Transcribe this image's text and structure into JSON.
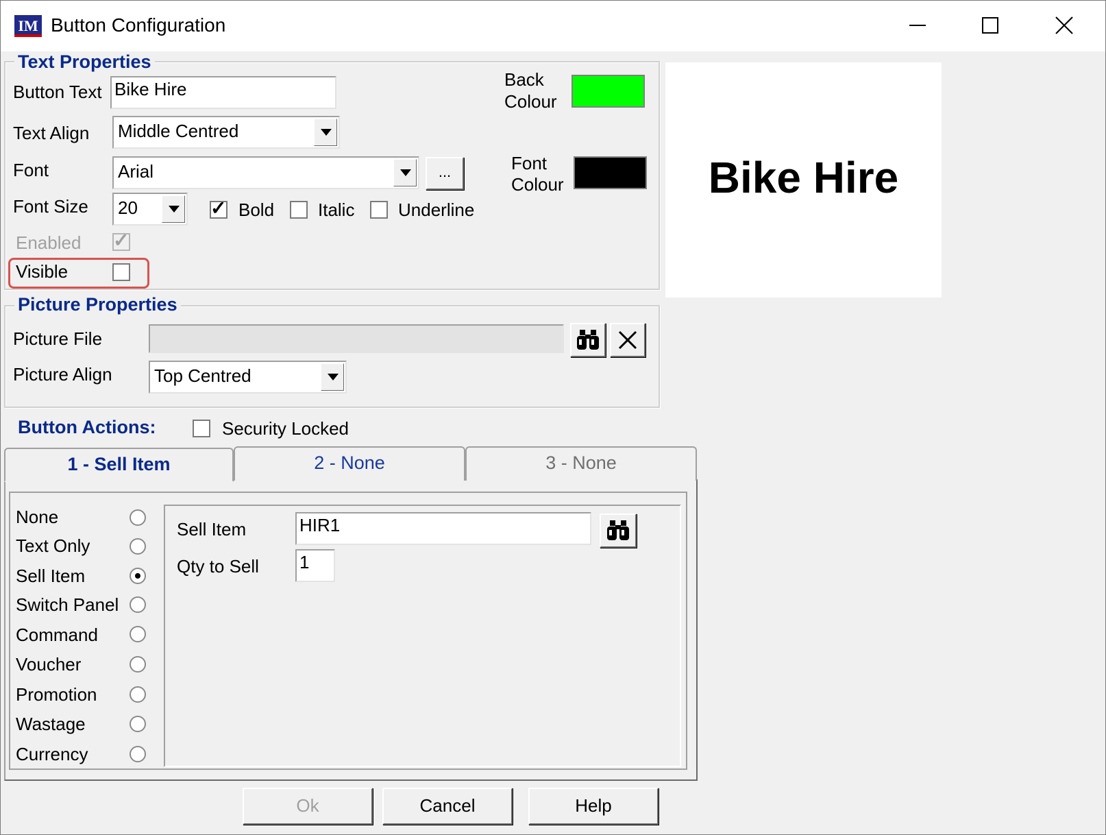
{
  "window": {
    "title": "Button Configuration",
    "app_icon": "IM",
    "minimize_icon": "minimize-icon",
    "maximize_icon": "maximize-icon",
    "close_icon": "close-icon"
  },
  "text_properties": {
    "title": "Text Properties",
    "button_text_label": "Button Text",
    "button_text_value": "Bike Hire",
    "text_align_label": "Text Align",
    "text_align_value": "Middle Centred",
    "font_label": "Font",
    "font_value": "Arial",
    "font_browse_label": "...",
    "font_size_label": "Font Size",
    "font_size_value": "20",
    "bold_label": "Bold",
    "bold_checked": true,
    "italic_label": "Italic",
    "italic_checked": false,
    "underline_label": "Underline",
    "underline_checked": false,
    "enabled_label": "Enabled",
    "enabled_checked": true,
    "visible_label": "Visible",
    "visible_checked": false,
    "back_colour_label_1": "Back",
    "back_colour_label_2": "Colour",
    "back_colour": "#00ff00",
    "font_colour_label_1": "Font",
    "font_colour_label_2": "Colour",
    "font_colour": "#000000"
  },
  "preview": {
    "text": "Bike Hire"
  },
  "picture_properties": {
    "title": "Picture Properties",
    "picture_file_label": "Picture File",
    "picture_file_value": "",
    "picture_align_label": "Picture Align",
    "picture_align_value": "Top Centred",
    "browse_icon": "binoculars-icon",
    "clear_icon": "close-x-icon"
  },
  "button_actions": {
    "title": "Button Actions:",
    "security_locked_label": "Security Locked",
    "security_locked_checked": false,
    "tabs": [
      {
        "label": "1 - Sell Item",
        "active": true
      },
      {
        "label": "2 - None",
        "active": false
      },
      {
        "label": "3 - None",
        "active": false
      }
    ],
    "action_types": [
      {
        "label": "None",
        "selected": false
      },
      {
        "label": "Text Only",
        "selected": false
      },
      {
        "label": "Sell Item",
        "selected": true
      },
      {
        "label": "Switch Panel",
        "selected": false
      },
      {
        "label": "Command",
        "selected": false
      },
      {
        "label": "Voucher",
        "selected": false
      },
      {
        "label": "Promotion",
        "selected": false
      },
      {
        "label": "Wastage",
        "selected": false
      },
      {
        "label": "Currency",
        "selected": false
      }
    ],
    "sell_item_label": "Sell Item",
    "sell_item_value": "HIR1",
    "qty_label": "Qty to Sell",
    "qty_value": "1"
  },
  "footer": {
    "ok_label": "Ok",
    "cancel_label": "Cancel",
    "help_label": "Help"
  }
}
